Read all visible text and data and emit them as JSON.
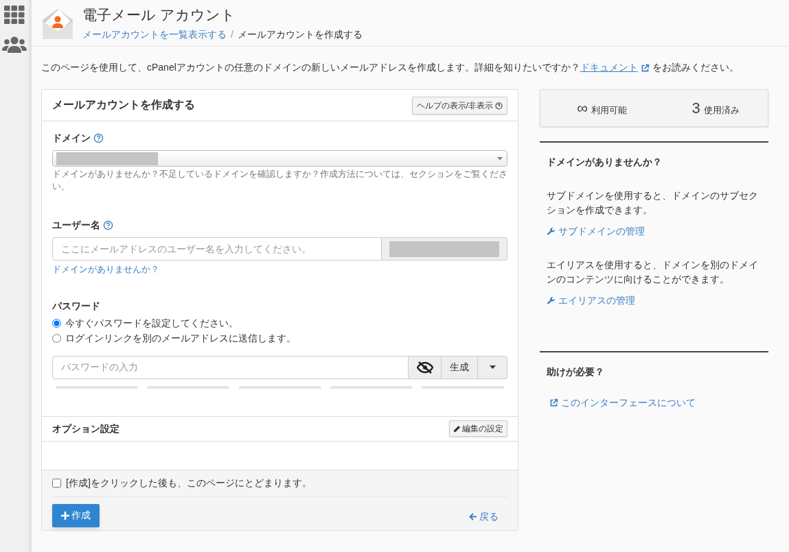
{
  "header": {
    "title": "電子メール アカウント",
    "breadcrumb": [
      {
        "label": "メールアカウントを一覧表示する",
        "kind": "link"
      },
      {
        "label": "メールアカウントを作成する",
        "kind": "current"
      }
    ],
    "separator": "/"
  },
  "intro": {
    "text": "このページを使用して、cPanelアカウントの任意のドメインの新しいメールアドレスを作成します。詳細を知りたいですか？",
    "link": "ドキュメント",
    "after": "をお読みください。"
  },
  "form": {
    "title": "メールアカウントを作成する",
    "help_button": "ヘルプの表示/非表示",
    "domain": {
      "label": "ドメイン",
      "help": "ドメインがありませんか？不足しているドメインを確認しますか？作成方法については、セクションをご覧ください。"
    },
    "username": {
      "label": "ユーザー名",
      "placeholder": "ここにメールアドレスのユーザー名を入力してください。",
      "link": "ドメインがありませんか？"
    },
    "password": {
      "label": "パスワード",
      "options": [
        {
          "label": "今すぐパスワードを設定してください。",
          "selected": true
        },
        {
          "label": "ログインリンクを別のメールアドレスに送信します。",
          "selected": false
        }
      ],
      "placeholder": "パスワードの入力",
      "generate": "生成"
    },
    "options": {
      "title": "オプション設定",
      "edit_button": "編集の設定"
    },
    "stay": {
      "label": "[作成]をクリックした後も、このページにとどまります。",
      "checked": false
    },
    "create_button": "作成",
    "back_link": "戻る"
  },
  "stats": [
    {
      "value": "∞",
      "label": "利用可能"
    },
    {
      "value": "3",
      "label": "使用済み"
    }
  ],
  "sidebar_sections": [
    {
      "title": "ドメインがありませんか？",
      "items": [
        {
          "text": "サブドメインを使用すると、ドメインのサブセクションを作成できます。",
          "link": "サブドメインの管理"
        },
        {
          "text": "エイリアスを使用すると、ドメインを別のドメインのコンテンツに向けることができます。",
          "link": "エイリアスの管理"
        }
      ]
    },
    {
      "title": "助けが必要？",
      "items": [
        {
          "link": "このインターフェースについて",
          "kind": "external"
        }
      ]
    }
  ]
}
